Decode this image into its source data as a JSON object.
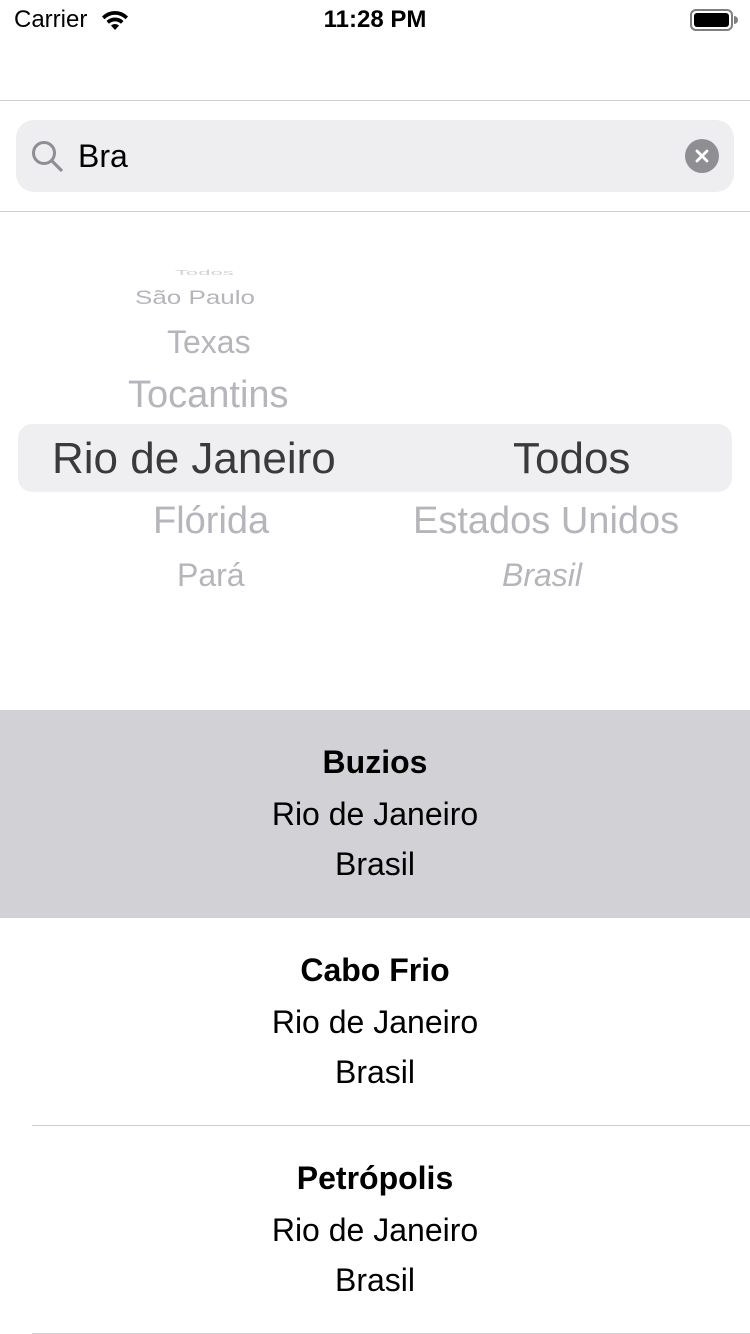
{
  "status_bar": {
    "carrier": "Carrier",
    "time": "11:28 PM",
    "wifi_icon": "wifi-icon",
    "battery_icon": "battery-icon"
  },
  "search": {
    "value": "Bra",
    "icon": "search-icon",
    "clear_icon": "clear-icon"
  },
  "picker": {
    "left_column": {
      "above": [
        "Todos",
        "São Paulo",
        "Texas",
        "Tocantins"
      ],
      "selected": "Rio de Janeiro",
      "below": [
        "Flórida",
        "Pará"
      ]
    },
    "right_column": {
      "selected": "Todos",
      "below": [
        "Estados Unidos",
        "Brasil"
      ]
    }
  },
  "results": [
    {
      "city": "Buzios",
      "state": "Rio de Janeiro",
      "country": "Brasil",
      "selected": true
    },
    {
      "city": "Cabo Frio",
      "state": "Rio de Janeiro",
      "country": "Brasil",
      "selected": false
    },
    {
      "city": "Petrópolis",
      "state": "Rio de Janeiro",
      "country": "Brasil",
      "selected": false
    }
  ],
  "colors": {
    "selected_row": "#d1d1d6",
    "search_bg": "#eeeef0",
    "picker_fade_text": "#b5b5ba"
  }
}
